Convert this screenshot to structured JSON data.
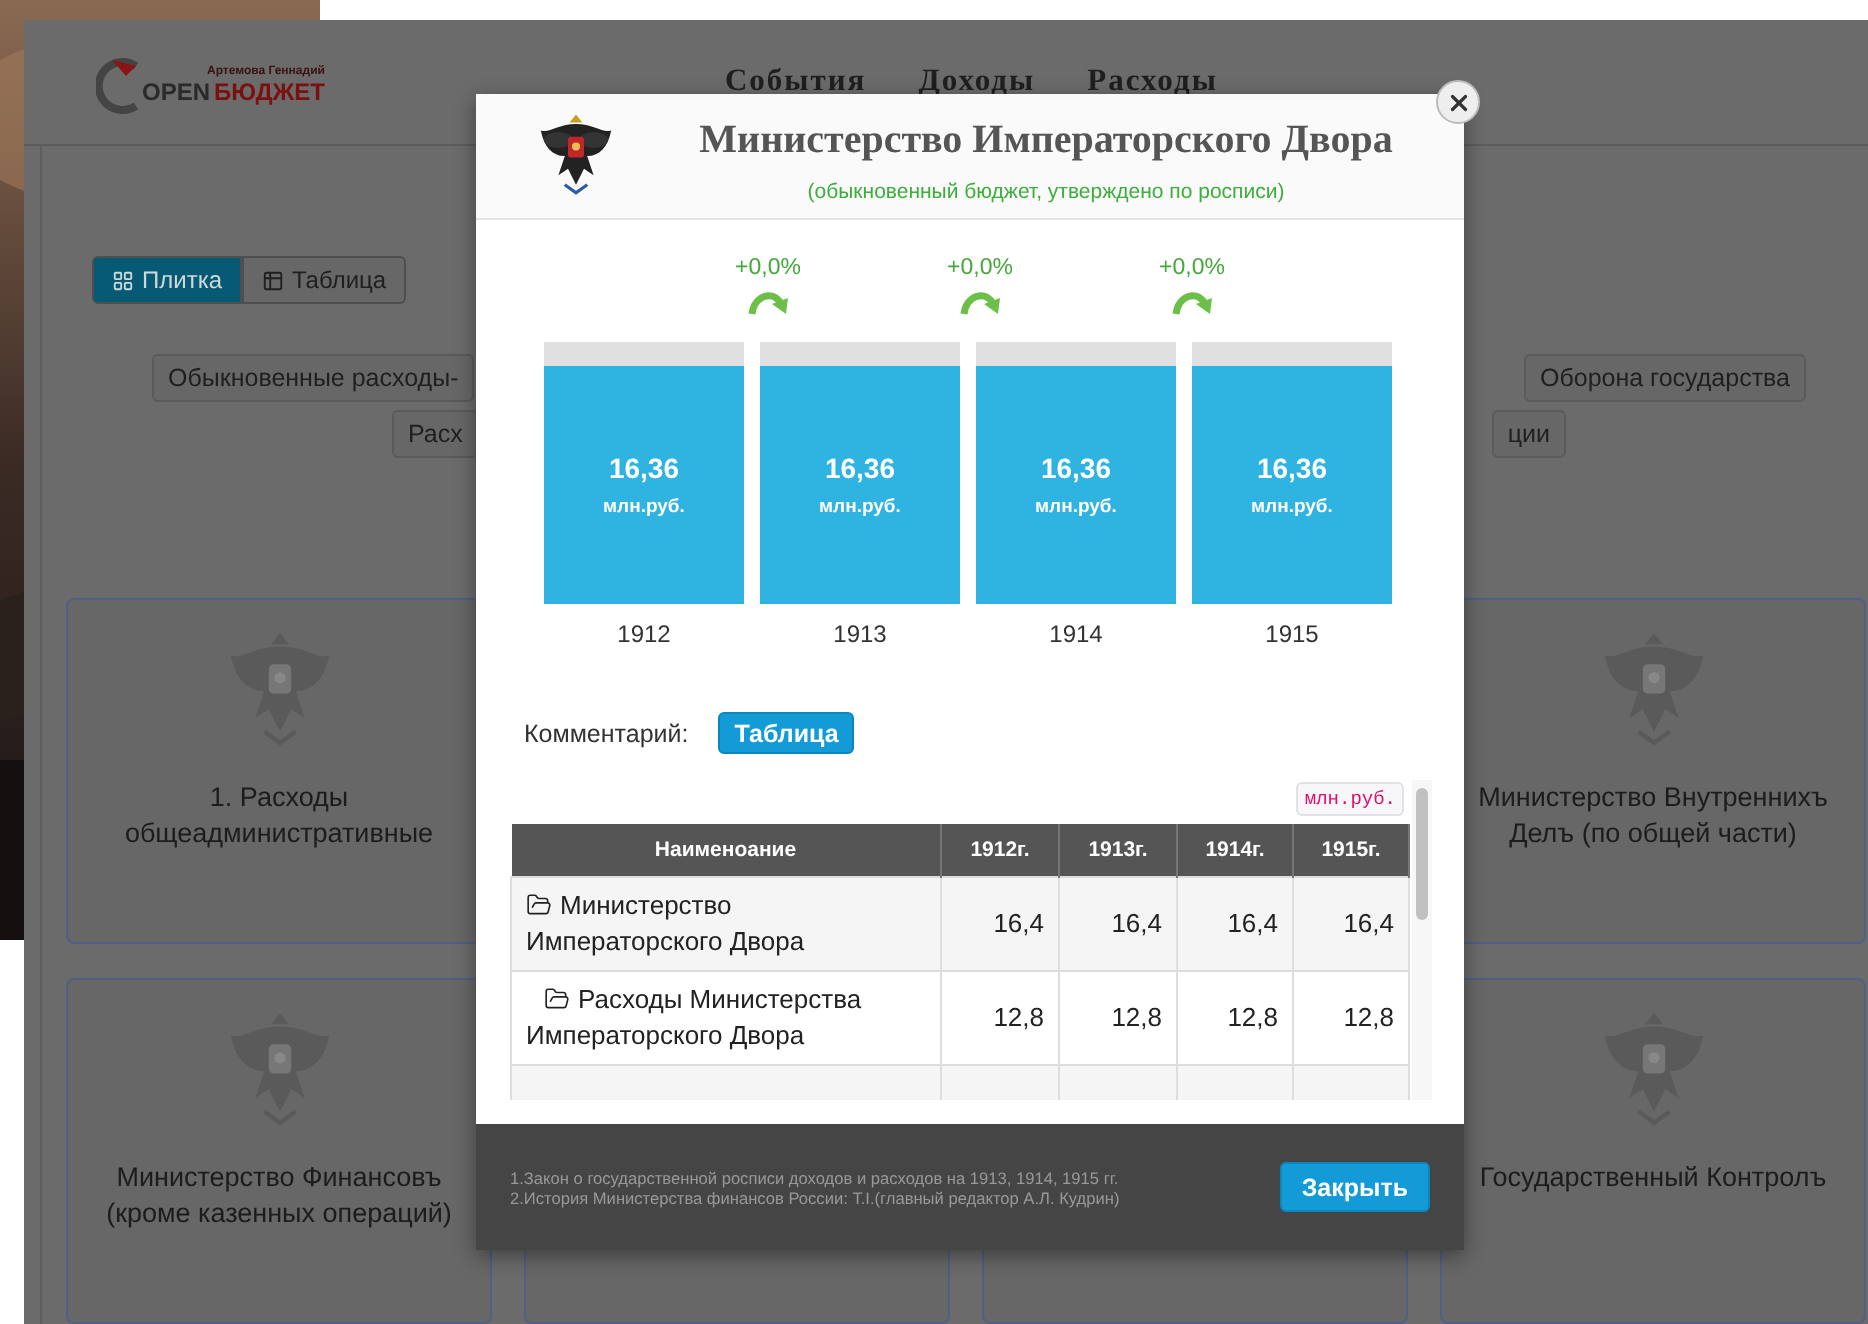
{
  "background_page": {
    "logo": {
      "tagline": "Артемова Геннадий",
      "word_1": "OPEN",
      "word_2": "БЮДЖЕТ"
    },
    "nav": [
      {
        "label": "События"
      },
      {
        "label": "Доходы"
      },
      {
        "label": "Расходы"
      }
    ],
    "view_toggle": [
      {
        "label": "Плитка",
        "selected": true
      },
      {
        "label": "Таблица",
        "selected": false
      }
    ],
    "filter_rows": [
      [
        "Обыкновенные расходы-",
        "Оборона государства"
      ],
      [
        "Расх",
        "ции"
      ]
    ],
    "card_rows": [
      {
        "left": "1. Расходы общеадминистративные",
        "right": "Министерство Внутреннихъ Делъ (по общей части)"
      },
      {
        "left": "Министерство Финансовъ (кроме казенных операций)",
        "right": "Государственный Контролъ"
      }
    ]
  },
  "dialog": {
    "title": "Министерство Императорского Двора",
    "subtitle": "(обыкновенный бюджет, утверждено по росписи)",
    "changes": [
      {
        "text": "+0,0%"
      },
      {
        "text": "+0,0%"
      },
      {
        "text": "+0,0%"
      }
    ],
    "years": [
      {
        "label": "1912",
        "value": "16,36",
        "unit": "млн.руб.",
        "level": 0.91
      },
      {
        "label": "1913",
        "value": "16,36",
        "unit": "млн.руб.",
        "level": 0.91
      },
      {
        "label": "1914",
        "value": "16,36",
        "unit": "млн.руб.",
        "level": 0.91
      },
      {
        "label": "1915",
        "value": "16,36",
        "unit": "млн.руб.",
        "level": 0.91
      }
    ],
    "comment_label": "Комментарий:",
    "comment_button": "Таблица",
    "unit_badge": "млн.руб.",
    "table": {
      "columns": [
        "Наименоание",
        "1912г.",
        "1913г.",
        "1914г.",
        "1915г."
      ],
      "rows": [
        {
          "name": "Министерство Императорского Двора",
          "values": [
            "16,4",
            "16,4",
            "16,4",
            "16,4"
          ],
          "children": [
            {
              "name": "Расходы Министерства Императорского Двора",
              "values": [
                "12,8",
                "12,8",
                "12,8",
                "12,8"
              ]
            }
          ]
        }
      ]
    },
    "footer": {
      "notes": [
        "1.Закон о государственной росписи доходов и расходов на 1913, 1914, 1915 гг.",
        "2.История Министерства финансов России: T.I.(главный редактор А.Л. Кудрин)"
      ],
      "close_button": "Закрыть"
    }
  }
}
